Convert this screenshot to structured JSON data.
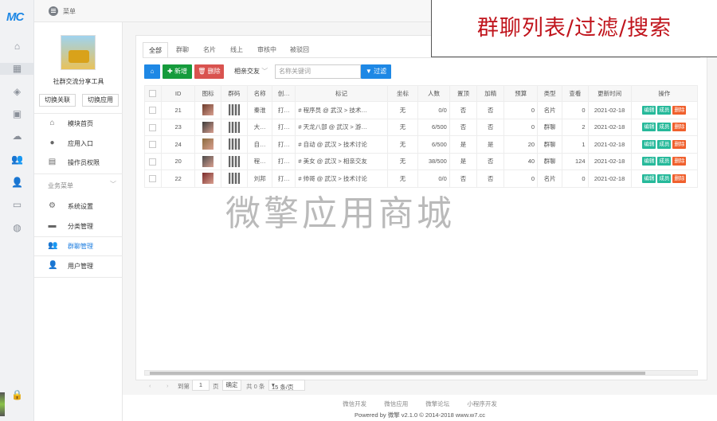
{
  "logo": "MC",
  "topbar": {
    "menu_label": "菜单"
  },
  "sidebar": {
    "app_name": "社群交流分享工具",
    "switch_link": "切换关联",
    "switch_app": "切换应用",
    "items_top": [
      {
        "label": "模块首页",
        "icon": "home-icon"
      },
      {
        "label": "应用入口",
        "icon": "chat-icon"
      },
      {
        "label": "操作员权限",
        "icon": "permission-icon"
      }
    ],
    "group_label": "业务菜单",
    "items_business": [
      {
        "label": "系统设置",
        "icon": "gear-icon"
      },
      {
        "label": "分类管理",
        "icon": "folder-icon"
      },
      {
        "label": "群聊管理",
        "icon": "group-icon"
      },
      {
        "label": "用户管理",
        "icon": "user-icon"
      }
    ]
  },
  "tabs": [
    "全部",
    "群聊",
    "名片",
    "线上",
    "审核中",
    "被驳回"
  ],
  "toolbar": {
    "add_label": "✚ 新增",
    "delete_label": "🗑 删除",
    "select_value": "相亲交友",
    "search_placeholder": "名称关键词",
    "filter_label": "过滤"
  },
  "table": {
    "headers": [
      "",
      "ID",
      "图标",
      "群码",
      "名称",
      "创…",
      "标记",
      "坐标",
      "人数",
      "置顶",
      "加精",
      "预算",
      "类型",
      "查看",
      "更新时间",
      "操作"
    ],
    "rows": [
      {
        "id": "21",
        "name": "秦淮",
        "creator": "打…",
        "tag": "# 程序员 @ 武汉 > 技术…",
        "coord": "无",
        "people": "0/0",
        "top": "否",
        "fine": "否",
        "budget": "0",
        "type": "名片",
        "views": "0",
        "updated": "2021-02-18"
      },
      {
        "id": "23",
        "name": "大…",
        "creator": "打…",
        "tag": "# 天龙八部 @ 武汉 > 游…",
        "coord": "无",
        "people": "6/500",
        "top": "否",
        "fine": "否",
        "budget": "0",
        "type": "群聊",
        "views": "2",
        "updated": "2021-02-18"
      },
      {
        "id": "24",
        "name": "自…",
        "creator": "打…",
        "tag": "# 自动 @ 武汉 > 技术讨论",
        "coord": "无",
        "people": "6/500",
        "top": "是",
        "fine": "是",
        "budget": "20",
        "type": "群聊",
        "views": "1",
        "updated": "2021-02-18"
      },
      {
        "id": "20",
        "name": "程…",
        "creator": "打…",
        "tag": "# 美女 @ 武汉 > 相亲交友",
        "coord": "无",
        "people": "38/500",
        "top": "是",
        "fine": "否",
        "budget": "40",
        "type": "群聊",
        "views": "124",
        "updated": "2021-02-18"
      },
      {
        "id": "22",
        "name": "刘邦",
        "creator": "打…",
        "tag": "# 帅哥 @ 武汉 > 技术讨论",
        "coord": "无",
        "people": "0/0",
        "top": "否",
        "fine": "否",
        "budget": "0",
        "type": "名片",
        "views": "0",
        "updated": "2021-02-18"
      }
    ],
    "actions": {
      "edit": "编辑",
      "members": "成员",
      "delete": "删除"
    }
  },
  "pager": {
    "goto": "到第",
    "page": "1",
    "page_unit": "页",
    "confirm": "确定",
    "total": "共 0 条",
    "per_page": "15 条/页"
  },
  "footer": {
    "links": [
      "微信开发",
      "微信应用",
      "微擎论坛",
      "小程序开发"
    ],
    "copyright": "Powered by 微擎 v2.1.0 © 2014-2018 www.w7.cc"
  },
  "overlay_title": "群聊列表/过滤/搜索",
  "watermark": "微擎应用商城",
  "colors": {
    "primary": "#1e88e5",
    "success": "#159b3c",
    "danger": "#d9534f",
    "teal": "#26b99a",
    "orange": "#f0602d",
    "overlay_red": "#c0141c"
  }
}
